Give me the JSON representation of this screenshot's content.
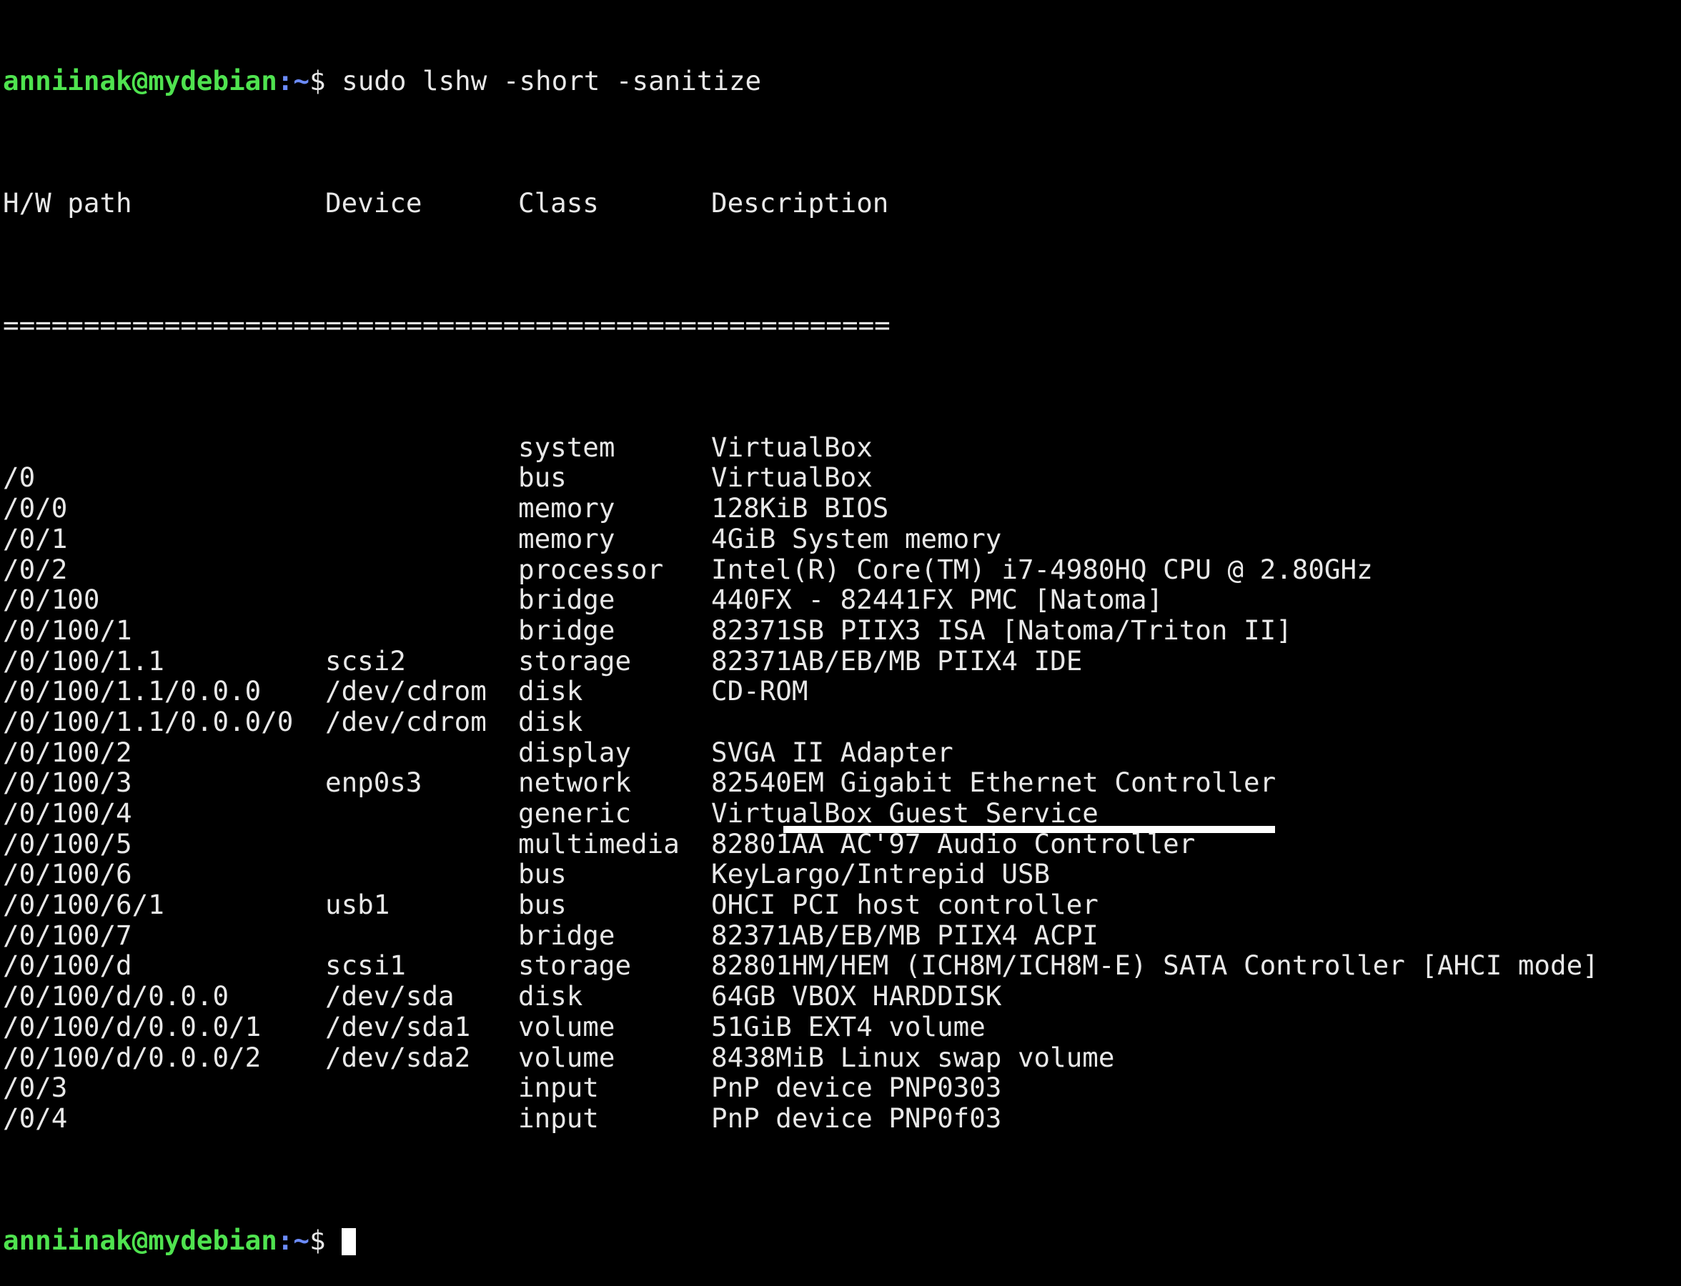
{
  "prompt": {
    "user_host": "anniinak@mydebian",
    "path": ":~",
    "symbol": "$ "
  },
  "command": "sudo lshw -short -sanitize",
  "header": {
    "path": "H/W path",
    "device": "Device",
    "class": "Class",
    "description": "Description"
  },
  "separator": "=======================================================",
  "rows": [
    {
      "path": "",
      "device": "",
      "class": "system",
      "description": "VirtualBox"
    },
    {
      "path": "/0",
      "device": "",
      "class": "bus",
      "description": "VirtualBox"
    },
    {
      "path": "/0/0",
      "device": "",
      "class": "memory",
      "description": "128KiB BIOS"
    },
    {
      "path": "/0/1",
      "device": "",
      "class": "memory",
      "description": "4GiB System memory"
    },
    {
      "path": "/0/2",
      "device": "",
      "class": "processor",
      "description": "Intel(R) Core(TM) i7-4980HQ CPU @ 2.80GHz"
    },
    {
      "path": "/0/100",
      "device": "",
      "class": "bridge",
      "description": "440FX - 82441FX PMC [Natoma]"
    },
    {
      "path": "/0/100/1",
      "device": "",
      "class": "bridge",
      "description": "82371SB PIIX3 ISA [Natoma/Triton II]"
    },
    {
      "path": "/0/100/1.1",
      "device": "scsi2",
      "class": "storage",
      "description": "82371AB/EB/MB PIIX4 IDE"
    },
    {
      "path": "/0/100/1.1/0.0.0",
      "device": "/dev/cdrom",
      "class": "disk",
      "description": "CD-ROM"
    },
    {
      "path": "/0/100/1.1/0.0.0/0",
      "device": "/dev/cdrom",
      "class": "disk",
      "description": ""
    },
    {
      "path": "/0/100/2",
      "device": "",
      "class": "display",
      "description": "SVGA II Adapter"
    },
    {
      "path": "/0/100/3",
      "device": "enp0s3",
      "class": "network",
      "description": "82540EM Gigabit Ethernet Controller"
    },
    {
      "path": "/0/100/4",
      "device": "",
      "class": "generic",
      "description": "VirtualBox Guest Service"
    },
    {
      "path": "/0/100/5",
      "device": "",
      "class": "multimedia",
      "description": "82801AA AC'97 Audio Controller"
    },
    {
      "path": "/0/100/6",
      "device": "",
      "class": "bus",
      "description": "KeyLargo/Intrepid USB"
    },
    {
      "path": "/0/100/6/1",
      "device": "usb1",
      "class": "bus",
      "description": "OHCI PCI host controller"
    },
    {
      "path": "/0/100/7",
      "device": "",
      "class": "bridge",
      "description": "82371AB/EB/MB PIIX4 ACPI"
    },
    {
      "path": "/0/100/d",
      "device": "scsi1",
      "class": "storage",
      "description": "82801HM/HEM (ICH8M/ICH8M-E) SATA Controller [AHCI mode]"
    },
    {
      "path": "/0/100/d/0.0.0",
      "device": "/dev/sda",
      "class": "disk",
      "description": "64GB VBOX HARDDISK"
    },
    {
      "path": "/0/100/d/0.0.0/1",
      "device": "/dev/sda1",
      "class": "volume",
      "description": "51GiB EXT4 volume"
    },
    {
      "path": "/0/100/d/0.0.0/2",
      "device": "/dev/sda2",
      "class": "volume",
      "description": "8438MiB Linux swap volume"
    },
    {
      "path": "/0/3",
      "device": "",
      "class": "input",
      "description": "PnP device PNP0303"
    },
    {
      "path": "/0/4",
      "device": "",
      "class": "input",
      "description": "PnP device PNP0f03"
    }
  ],
  "colors": {
    "background": "#000000",
    "foreground": "#e8e8e8",
    "prompt_user": "#4fe34f",
    "prompt_path": "#6c8cff"
  }
}
